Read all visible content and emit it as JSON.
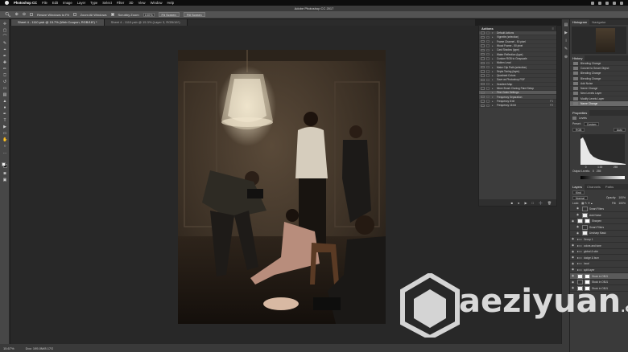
{
  "menubar": {
    "app": "Photoshop CC",
    "items": [
      "File",
      "Edit",
      "Image",
      "Layer",
      "Type",
      "Select",
      "Filter",
      "3D",
      "View",
      "Window",
      "Help"
    ]
  },
  "window_title": "Adobe Photoshop CC 2017",
  "options_bar": {
    "resize_windows": "Resize Windows to Fit",
    "zoom_all": "Zoom All Windows",
    "scrubby": "Scrubby Zoom",
    "zoom_value": "100%",
    "fit_screen": "Fit Screen",
    "fill_screen": "Fill Screen"
  },
  "tabs": [
    {
      "label": "Sheet 4 - 1110.psb @ 15.7% (Web Coupon, RGB/16*) *",
      "active": true
    },
    {
      "label": "Sheet 4 - 1110.psb @ 15.3% (Layer 3, RGB/16*)",
      "active": false
    }
  ],
  "status": {
    "zoom": "15.67%",
    "doc": "Doc: 195.0M/8.17G"
  },
  "actions_panel": {
    "title": "Actions",
    "rows": [
      {
        "label": "Default Actions",
        "folder": true
      },
      {
        "label": "Vignette (selection)"
      },
      {
        "label": "Frame Channel - 50 pixel"
      },
      {
        "label": "Wood Frame - 50 pixel"
      },
      {
        "label": "Cast Shadow (type)"
      },
      {
        "label": "Water Reflection (type)"
      },
      {
        "label": "Custom RGB to Grayscale"
      },
      {
        "label": "Molten Lead"
      },
      {
        "label": "Make Clip Path (selection)"
      },
      {
        "label": "Sepia Toning (layer)"
      },
      {
        "label": "Quadrant Colors"
      },
      {
        "label": "Save as Photoshop PDF"
      },
      {
        "label": "Gradient Map"
      },
      {
        "label": "Mixer Brush Cloning Paint Setup"
      },
      {
        "label": "Fine Grain Settings",
        "selected": true
      },
      {
        "label": "Frequency Separation",
        "folder": true
      },
      {
        "label": "Frequency 8 bit",
        "key": "F1"
      },
      {
        "label": "Frequency 16 bit",
        "key": "F2"
      }
    ]
  },
  "histogram_panel": {
    "tabs": [
      "Histogram",
      "Navigator"
    ]
  },
  "history_panel": {
    "title": "History",
    "rows": [
      {
        "label": "Blending Change"
      },
      {
        "label": "Convert to Smart Object"
      },
      {
        "label": "Blending Change"
      },
      {
        "label": "Blending Change"
      },
      {
        "label": "Add Noise"
      },
      {
        "label": "Name Change"
      },
      {
        "label": "New Levels Layer"
      },
      {
        "label": "Modify Levels Layer"
      },
      {
        "label": "Name Change",
        "selected": true
      }
    ]
  },
  "properties_panel": {
    "title": "Properties",
    "adjustment": "Levels",
    "preset_label": "Preset:",
    "preset": "Custom",
    "channel": "RGB",
    "auto": "Auto",
    "input_values": [
      "0",
      "1.00",
      "255"
    ],
    "output_label": "Output Levels:",
    "output_values": [
      "0",
      "255"
    ]
  },
  "layers_panel": {
    "tabs": [
      "Layers",
      "Channels",
      "Paths"
    ],
    "kind": "Kind",
    "blend": "Normal",
    "opacity_label": "Opacity:",
    "opacity": "100%",
    "lock_label": "Lock:",
    "fill_label": "Fill:",
    "fill": "100%",
    "rows": [
      {
        "label": "Smart Filters",
        "sub": true
      },
      {
        "label": "Add Noise",
        "sub": true
      },
      {
        "label": "Sharpen"
      },
      {
        "label": "Smart Filters",
        "sub": true
      },
      {
        "label": "Unsharp Mask",
        "sub": true
      },
      {
        "label": "Group 1",
        "folder": true
      },
      {
        "label": "colors and tone",
        "folder": true
      },
      {
        "label": "global & skin",
        "folder": true
      },
      {
        "label": "dodge & burn",
        "folder": true
      },
      {
        "label": "local",
        "folder": true
      },
      {
        "label": "split layer",
        "folder": true
      },
      {
        "label": "Stock in OBJ1",
        "selected": true
      },
      {
        "label": "Stock in OBJ1"
      },
      {
        "label": "Stock in OBJ1"
      }
    ]
  },
  "watermark": {
    "text": "aeziyuan",
    "suffix": ".com"
  }
}
